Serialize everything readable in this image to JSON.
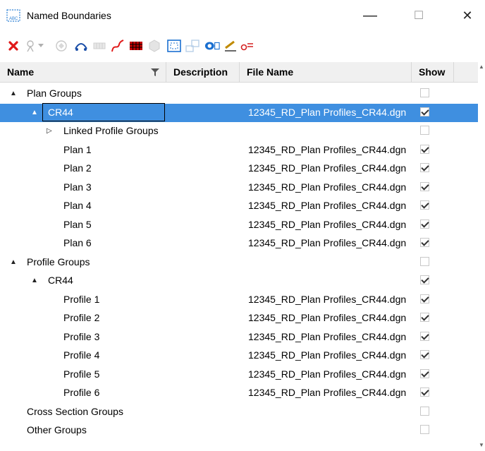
{
  "window": {
    "title": "Named Boundaries",
    "controls": {
      "minimize": "—",
      "maximize": "☐",
      "close": "✕"
    }
  },
  "toolbar": {
    "icons": [
      "delete-icon",
      "properties-icon",
      "dropdown-icon",
      "disabled-cube-icon",
      "civil-plan-icon",
      "grid-icon",
      "curve-icon",
      "table-icon",
      "disabled-3d-icon",
      "frame-icon",
      "disabled-plan-icon",
      "eye-icon",
      "pen-icon",
      "profile-icon"
    ]
  },
  "columns": {
    "name": "Name",
    "description": "Description",
    "file_name": "File Name",
    "show": "Show"
  },
  "rows": [
    {
      "level": 0,
      "expand": "▲",
      "name": "Plan Groups",
      "file": "",
      "show": false
    },
    {
      "level": 1,
      "expand": "▲",
      "name": "CR44",
      "file": "12345_RD_Plan Profiles_CR44.dgn",
      "show": true,
      "selected": true
    },
    {
      "level": 2,
      "expand": "▷",
      "name": "Linked Profile Groups",
      "file": "",
      "show": false
    },
    {
      "level": 3,
      "name": "Plan 1",
      "file": "12345_RD_Plan Profiles_CR44.dgn",
      "show": true
    },
    {
      "level": 3,
      "name": "Plan 2",
      "file": "12345_RD_Plan Profiles_CR44.dgn",
      "show": true
    },
    {
      "level": 3,
      "name": "Plan 3",
      "file": "12345_RD_Plan Profiles_CR44.dgn",
      "show": true
    },
    {
      "level": 3,
      "name": "Plan 4",
      "file": "12345_RD_Plan Profiles_CR44.dgn",
      "show": true
    },
    {
      "level": 3,
      "name": "Plan 5",
      "file": "12345_RD_Plan Profiles_CR44.dgn",
      "show": true
    },
    {
      "level": 3,
      "name": "Plan 6",
      "file": "12345_RD_Plan Profiles_CR44.dgn",
      "show": true
    },
    {
      "level": 0,
      "expand": "▲",
      "name": "Profile Groups",
      "file": "",
      "show": false
    },
    {
      "level": 1,
      "expand": "▲",
      "name": "CR44",
      "file": "",
      "show": true
    },
    {
      "level": 3,
      "name": "Profile 1",
      "file": "12345_RD_Plan Profiles_CR44.dgn",
      "show": true
    },
    {
      "level": 3,
      "name": "Profile 2",
      "file": "12345_RD_Plan Profiles_CR44.dgn",
      "show": true
    },
    {
      "level": 3,
      "name": "Profile 3",
      "file": "12345_RD_Plan Profiles_CR44.dgn",
      "show": true
    },
    {
      "level": 3,
      "name": "Profile 4",
      "file": "12345_RD_Plan Profiles_CR44.dgn",
      "show": true
    },
    {
      "level": 3,
      "name": "Profile 5",
      "file": "12345_RD_Plan Profiles_CR44.dgn",
      "show": true
    },
    {
      "level": 3,
      "name": "Profile 6",
      "file": "12345_RD_Plan Profiles_CR44.dgn",
      "show": true
    },
    {
      "level": 0,
      "name": "Cross Section Groups",
      "file": "",
      "show": false
    },
    {
      "level": 0,
      "name": "Other Groups",
      "file": "",
      "show": false
    }
  ]
}
